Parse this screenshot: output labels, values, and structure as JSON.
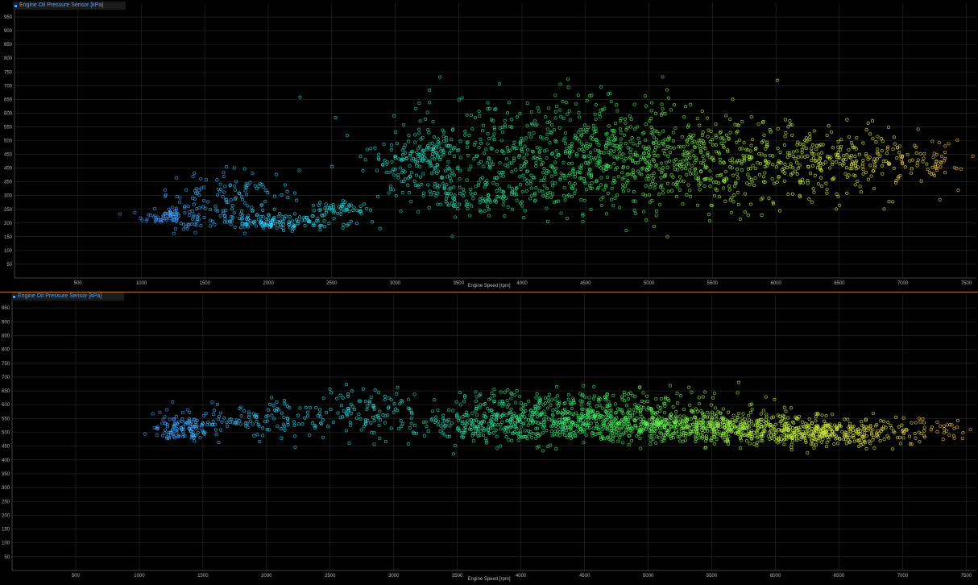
{
  "chart_data": [
    {
      "type": "scatter",
      "legend": "Engine Oil Pressure Sensor [kPa]",
      "xlabel": "Engine Speed [rpm]",
      "ylabel": "",
      "xlim": [
        0,
        7580
      ],
      "ylim": [
        0,
        1000
      ],
      "xticks": [
        500,
        1000,
        1500,
        2000,
        2500,
        3000,
        3500,
        4000,
        4500,
        5000,
        5500,
        6000,
        6500,
        7000,
        7500
      ],
      "yticks": [
        50,
        100,
        150,
        200,
        250,
        300,
        350,
        400,
        450,
        500,
        550,
        600,
        650,
        700,
        750,
        800,
        850,
        900,
        950
      ],
      "grid": true,
      "color_scale": "engine speed (blue low → yellow high)",
      "series": [
        {
          "clusters": [
            {
              "x": 1250,
              "y": 225,
              "sx": 120,
              "sy": 22,
              "n": 90
            },
            {
              "x": 1700,
              "y": 300,
              "sx": 250,
              "sy": 45,
              "n": 110
            },
            {
              "x": 2100,
              "y": 205,
              "sx": 260,
              "sy": 14,
              "n": 150
            },
            {
              "x": 2550,
              "y": 250,
              "sx": 120,
              "sy": 12,
              "n": 50
            },
            {
              "x": 3200,
              "y": 445,
              "sx": 200,
              "sy": 55,
              "n": 150
            },
            {
              "x": 3600,
              "y": 300,
              "sx": 300,
              "sy": 35,
              "n": 120
            },
            {
              "x": 4300,
              "y": 420,
              "sx": 650,
              "sy": 90,
              "n": 480
            },
            {
              "x": 5400,
              "y": 410,
              "sx": 650,
              "sy": 80,
              "n": 480
            },
            {
              "x": 6600,
              "y": 430,
              "sx": 500,
              "sy": 50,
              "n": 280
            },
            {
              "x": 4500,
              "y": 560,
              "sx": 650,
              "sy": 70,
              "n": 160
            }
          ]
        }
      ]
    },
    {
      "type": "scatter",
      "legend": "Engine Oil Pressure Sensor [kPa]",
      "xlabel": "Engine Speed [rpm]",
      "ylabel": "",
      "xlim": [
        0,
        7580
      ],
      "ylim": [
        0,
        1000
      ],
      "xticks": [
        500,
        1000,
        1500,
        2000,
        2500,
        3000,
        3500,
        4000,
        4500,
        5000,
        5500,
        6000,
        6500,
        7000,
        7500
      ],
      "yticks": [
        50,
        100,
        150,
        200,
        250,
        300,
        350,
        400,
        450,
        500,
        550,
        600,
        650,
        700,
        750,
        800,
        850,
        900,
        950
      ],
      "grid": true,
      "color_scale": "engine speed (blue low → yellow high)",
      "series": [
        {
          "clusters": [
            {
              "x": 1350,
              "y": 510,
              "sx": 110,
              "sy": 20,
              "n": 110
            },
            {
              "x": 1900,
              "y": 545,
              "sx": 320,
              "sy": 35,
              "n": 120
            },
            {
              "x": 2700,
              "y": 575,
              "sx": 260,
              "sy": 45,
              "n": 100
            },
            {
              "x": 3800,
              "y": 530,
              "sx": 350,
              "sy": 40,
              "n": 300
            },
            {
              "x": 4700,
              "y": 540,
              "sx": 500,
              "sy": 35,
              "n": 500
            },
            {
              "x": 5600,
              "y": 520,
              "sx": 500,
              "sy": 30,
              "n": 500
            },
            {
              "x": 6400,
              "y": 495,
              "sx": 350,
              "sy": 20,
              "n": 280
            },
            {
              "x": 7000,
              "y": 505,
              "sx": 300,
              "sy": 25,
              "n": 60
            },
            {
              "x": 4400,
              "y": 625,
              "sx": 700,
              "sy": 20,
              "n": 120
            }
          ]
        }
      ]
    }
  ]
}
